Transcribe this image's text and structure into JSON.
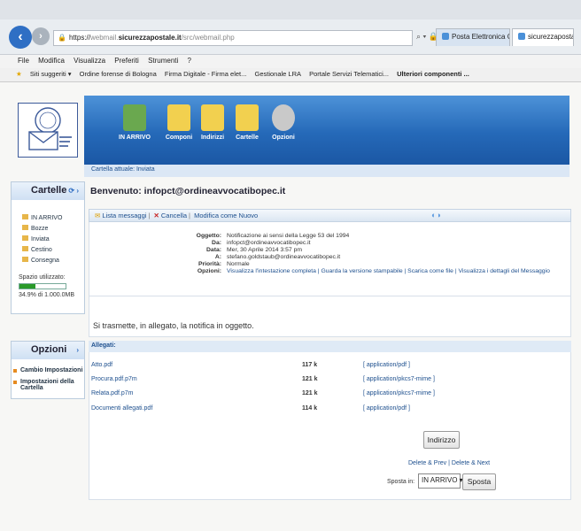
{
  "browser": {
    "url_scheme": "https://",
    "url_prefix": "webmail.",
    "url_domain": "sicurezzapostale.it",
    "url_path": "/src/webmail.php",
    "url_tools": "⌕ ▾ 🔒 C",
    "tabs": [
      {
        "label": "Posta Elettronica Certificata"
      },
      {
        "label": "sicurezzapostale.it"
      }
    ],
    "menu": [
      "File",
      "Modifica",
      "Visualizza",
      "Preferiti",
      "Strumenti",
      "?"
    ],
    "favorites": [
      "Siti suggeriti ▾",
      "Ordine forense di Bologna",
      "Firma Digitale - Firma elet...",
      "Gestionale LRA",
      "Portale Servizi Telematici...",
      "Ulteriori componenti ..."
    ]
  },
  "toolbar_icons": [
    {
      "label": "IN ARRIVO",
      "color": "#6aa84f"
    },
    {
      "label": "Componi",
      "color": "#f2d04f"
    },
    {
      "label": "Indirizzi",
      "color": "#f2d04f"
    },
    {
      "label": "Cartelle",
      "color": "#f2d04f"
    },
    {
      "label": "Opzioni",
      "color": "#c9c9c9"
    }
  ],
  "current_folder": "Cartella attuale: Inviata",
  "sidebar": {
    "folders_title": "Cartelle",
    "folders": [
      "IN ARRIVO",
      "Bozze",
      "Inviata",
      "Cestino",
      "Consegna"
    ],
    "usage_label": "Spazio utilizzato:",
    "usage_fraction": 0.349,
    "usage_text": "34.9% di 1.000.0MB",
    "options_title": "Opzioni",
    "options": [
      "Cambio Impostazioni",
      "Impostazioni della Cartella"
    ]
  },
  "message": {
    "welcome_label": "Benvenuto:",
    "welcome_user": "infopct@ordineavvocatibopec.it",
    "actions": {
      "list": "Lista messaggi",
      "delete": "Cancella",
      "mark_unread": "Modifica come Nuovo"
    },
    "headers": [
      {
        "label": "Oggetto:",
        "value": "Notificazione ai sensi della Legge 53 del 1994"
      },
      {
        "label": "Da:",
        "value": "infopct@ordineavvocatibopec.it"
      },
      {
        "label": "Data:",
        "value": "Mer, 30 Aprile 2014 3:57 pm"
      },
      {
        "label": "A:",
        "value": "stefano.goldstaub@ordineavvocatibopec.it"
      },
      {
        "label": "Priorità:",
        "value": "Normale"
      },
      {
        "label": "Opzioni:",
        "value": "Visualizza l'intestazione completa | Guarda la versione stampabile | Scarica come file | Visualizza i dettagli del Messaggio"
      }
    ],
    "body": "Si trasmette, in allegato, la notifica in oggetto."
  },
  "attachments": {
    "title": "Allegati:",
    "items": [
      {
        "name": "Atto.pdf",
        "size": "117 k",
        "type": "[ application/pdf ]"
      },
      {
        "name": "Procura.pdf.p7m",
        "size": "121 k",
        "type": "[ application/pkcs7-mime ]"
      },
      {
        "name": "Relata.pdf.p7m",
        "size": "121 k",
        "type": "[ application/pkcs7-mime ]"
      },
      {
        "name": "Documenti allegati.pdf",
        "size": "114 k",
        "type": "[ application/pdf ]"
      }
    ]
  },
  "controls": {
    "address_button": "Indirizzo",
    "delete_prev": "Delete & Prev",
    "delete_next": "Delete & Next",
    "separator": "|",
    "move_label": "Sposta in:",
    "move_selected": "IN ARRIVO ▾",
    "move_button": "Sposta"
  }
}
